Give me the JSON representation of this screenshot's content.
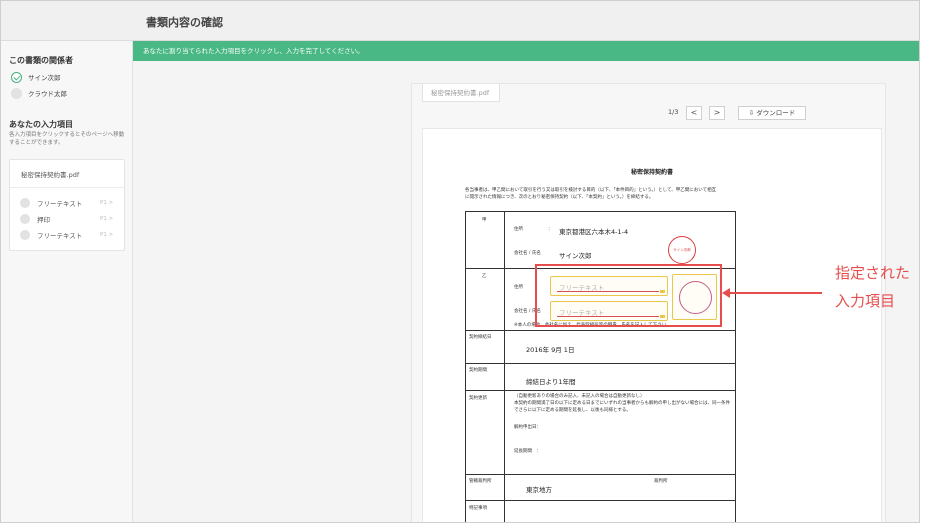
{
  "header": {
    "title": "書類内容の確認"
  },
  "banner": {
    "text": "あなたに割り当てられた入力項目をクリックし、入力を完了してください。"
  },
  "sidebar": {
    "parties_heading": "この書類の関係者",
    "parties": [
      {
        "name": "サイン次郎",
        "status": "done"
      },
      {
        "name": "クラウド太郎",
        "status": "pending"
      }
    ],
    "inputs_heading": "あなたの入力項目",
    "inputs_desc": "各入力項目をクリックするとそのページへ移動することができます。",
    "doc_name": "秘密保持契約書.pdf",
    "fields": [
      {
        "label": "フリーテキスト",
        "page": "P1 >"
      },
      {
        "label": "押印",
        "page": "P1 >"
      },
      {
        "label": "フリーテキスト",
        "page": "P1 >"
      }
    ]
  },
  "viewer": {
    "tab_label": "秘密保持契約書.pdf",
    "page_indicator": "1/3",
    "prev": "<",
    "next": ">",
    "download_label": "ダウンロード"
  },
  "document": {
    "title": "秘密保持契約書",
    "intro": "各当事者は、甲乙間において取引を行う又は取引を検討する目的（以下、「本件目的」という。）として、甲乙間において相互に開示された情報につき、次のとおり秘密保持契約（以下、「本契約」という。）を締結する。",
    "party_a_label": "甲",
    "party_b_label": "乙",
    "address_label": "住所",
    "address_colon": "：",
    "address_value": "東京都港区六本木4-1-4",
    "company_label": "会社名 / 氏名",
    "signer_value": "サイン次郎",
    "stamp_text": "サイン次郎",
    "placeholder_1": "フリーテキスト",
    "placeholder_2": "フリーテキスト",
    "note": "※本人の場合、会社名に加え、代表取締役等の職責、氏名を記入して下さい。",
    "contract_date_label": "契約締結日",
    "contract_date": "2016年 9月 1日",
    "period_label": "契約期間",
    "period_value": "締結日より1年間",
    "renewal_label": "契約更新",
    "renewal_text_1": "（自動更新ありの場合のみ記入、未記入の場合は自動更新なし）",
    "renewal_text_2": "本契約の期間満了日の以下に定める日までにいずれの当事者からも解約の申し出がない場合には、同一条件でさらに以下に定める期間を延長し、以後も同様とする。",
    "cancel_label": "解約申出日：",
    "extend_label": "延長期間　：",
    "court_label": "管轄裁判所",
    "court_value": "東京地方",
    "court_suffix": "裁判所",
    "special_label": "特記事項"
  },
  "annotation": {
    "callout_line1": "指定された",
    "callout_line2": "入力項目"
  },
  "colors": {
    "accent": "#4ab885",
    "highlight": "#e64d4d",
    "field_border": "#e8c84a"
  }
}
